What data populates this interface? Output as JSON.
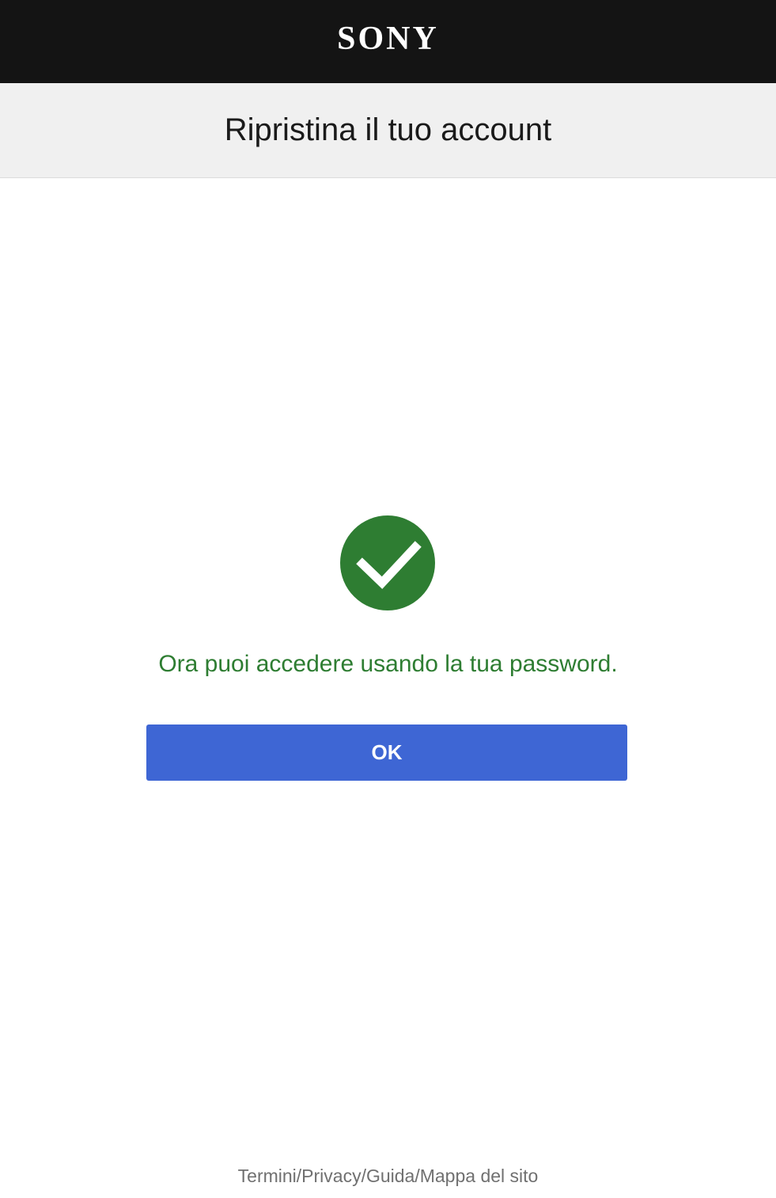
{
  "header": {
    "brand": "SONY",
    "background": "#141414"
  },
  "title_bar": {
    "title": "Ripristina il tuo account"
  },
  "main": {
    "status_icon": "checkmark-circle-icon",
    "status_color": "#2e7d32",
    "message": "Ora puoi accedere usando la tua password.",
    "ok_label": "OK",
    "ok_color": "#3e66d4"
  },
  "footer": {
    "links": [
      {
        "label": "Termini"
      },
      {
        "label": "Privacy"
      },
      {
        "label": "Guida"
      },
      {
        "label": "Mappa del sito"
      }
    ],
    "separator": "/"
  }
}
